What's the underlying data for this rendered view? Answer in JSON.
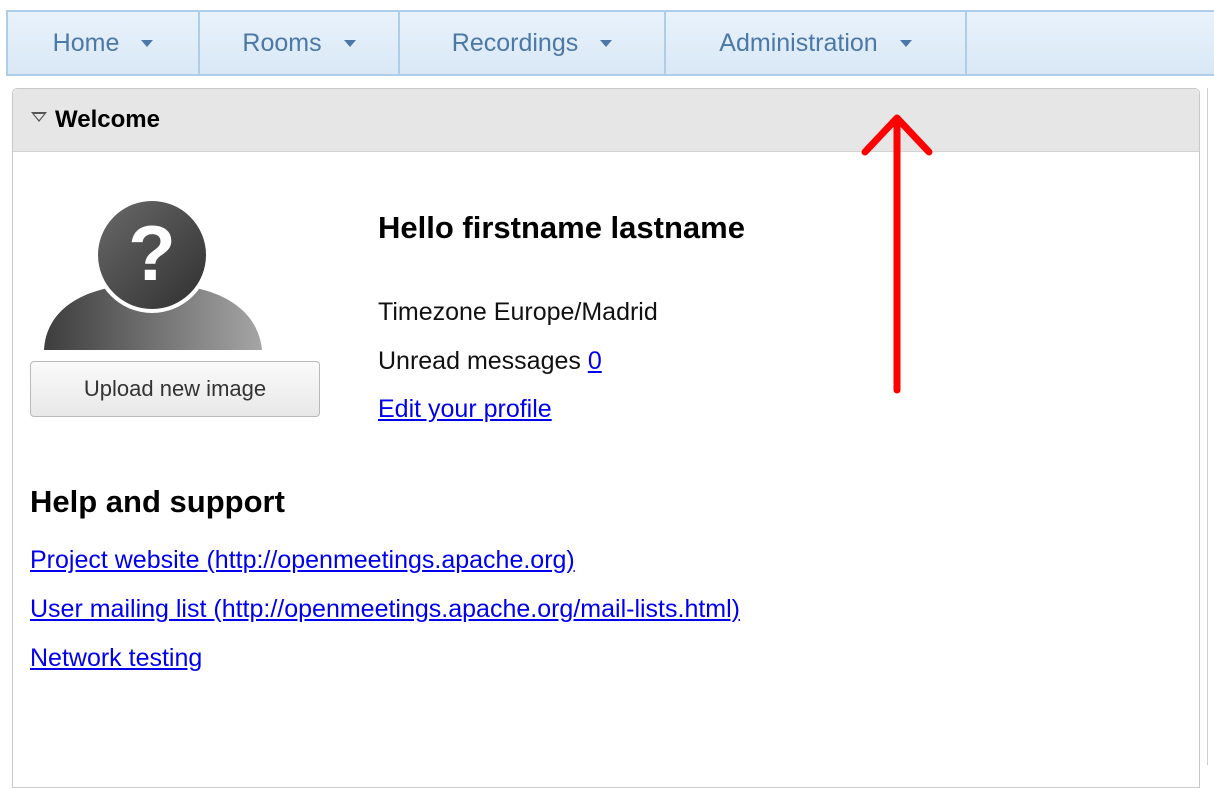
{
  "menu": {
    "items": [
      {
        "label": "Home"
      },
      {
        "label": "Rooms"
      },
      {
        "label": "Recordings"
      },
      {
        "label": "Administration"
      }
    ]
  },
  "panel": {
    "title": "Welcome"
  },
  "profile": {
    "upload_label": "Upload new image",
    "hello": "Hello firstname lastname",
    "timezone_text": "Timezone Europe/Madrid",
    "unread_label": "Unread messages",
    "unread_count": "0",
    "edit_profile": "Edit your profile"
  },
  "help": {
    "title": "Help and support",
    "links": [
      {
        "label": "Project website (http://openmeetings.apache.org)"
      },
      {
        "label": "User mailing list (http://openmeetings.apache.org/mail-lists.html)"
      },
      {
        "label": "Network testing"
      }
    ]
  },
  "colors": {
    "menu_text": "#4b78a6",
    "link": "#0000ee",
    "annotation_arrow": "#ff0000"
  },
  "icons": {
    "avatar": "unknown-user-avatar-icon",
    "collapse": "triangle-down-icon",
    "menu_dropdown": "caret-down-icon"
  }
}
